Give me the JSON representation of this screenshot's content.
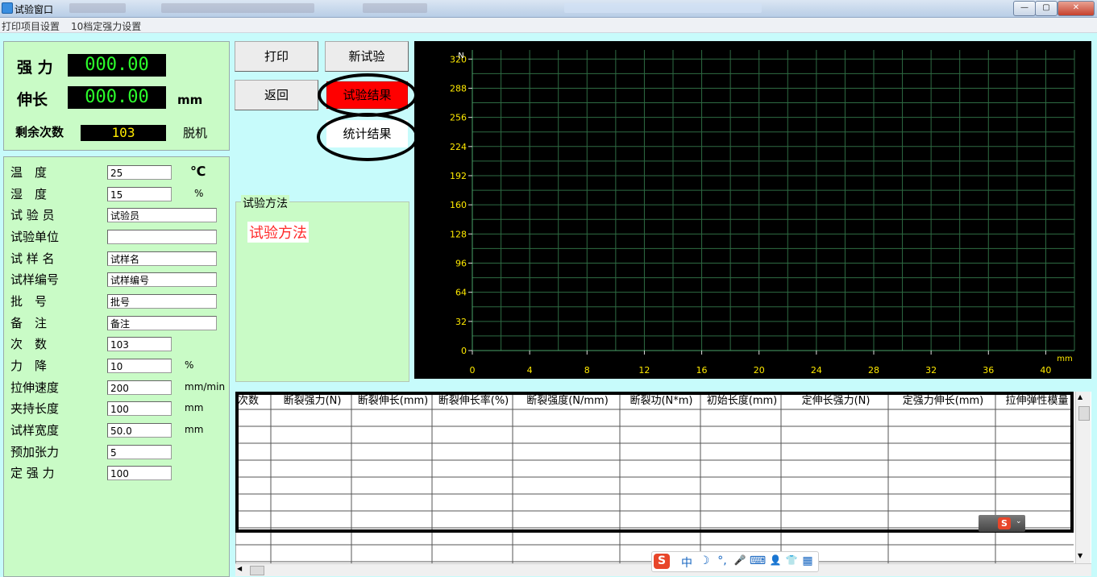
{
  "window": {
    "title": "试验窗口",
    "min": "—",
    "max": "▢",
    "close": "✕"
  },
  "menu": [
    "打印项目设置",
    "10档定强力设置"
  ],
  "readout": {
    "force_label": "强 力",
    "force_value": "000.00",
    "elong_label": "伸长",
    "elong_value": "000.00",
    "elong_unit": "mm",
    "remain_label": "剩余次数",
    "remain_value": "103",
    "status": "脱机"
  },
  "params": [
    {
      "label": "温　度",
      "value": "25",
      "unit": "℃"
    },
    {
      "label": "湿　度",
      "value": "15",
      "unit": "%"
    },
    {
      "label": "试 验 员",
      "value": "试验员",
      "unit": ""
    },
    {
      "label": "试验单位",
      "value": "",
      "unit": ""
    },
    {
      "label": "试 样 名",
      "value": "试样名",
      "unit": ""
    },
    {
      "label": "试样编号",
      "value": "试样编号",
      "unit": ""
    },
    {
      "label": "批　号",
      "value": "批号",
      "unit": ""
    },
    {
      "label": "备　注",
      "value": "备注",
      "unit": ""
    },
    {
      "label": "次　数",
      "value": "103",
      "unit": ""
    },
    {
      "label": "力　降",
      "value": "10",
      "unit": "%"
    },
    {
      "label": "拉伸速度",
      "value": "200",
      "unit": "mm/min"
    },
    {
      "label": "夹持长度",
      "value": "100",
      "unit": "mm"
    },
    {
      "label": "试样宽度",
      "value": "50.0",
      "unit": "mm"
    },
    {
      "label": "预加张力",
      "value": "5",
      "unit": ""
    },
    {
      "label": "定 强 力",
      "value": "100",
      "unit": ""
    }
  ],
  "buttons": {
    "print": "打印",
    "new_test": "新试验",
    "back": "返回",
    "results": "试验结果",
    "stats": "统计结果"
  },
  "method": {
    "group_label": "试验方法",
    "value": "试验方法"
  },
  "colors": {
    "results_button": "#ff0000",
    "chart_grid": "#2e6b43",
    "tick_text": "#ffea00"
  },
  "chart_data": {
    "type": "line",
    "x_ticks": [
      "0",
      "4",
      "8",
      "12",
      "16",
      "20",
      "24",
      "28",
      "32",
      "36",
      "40"
    ],
    "y_ticks": [
      "0",
      "32",
      "64",
      "96",
      "128",
      "160",
      "192",
      "224",
      "256",
      "288",
      "320"
    ],
    "xlabel": "mm",
    "ylabel": "N",
    "xlim": [
      0,
      42
    ],
    "ylim": [
      0,
      330
    ],
    "grid": true,
    "series": []
  },
  "table": {
    "headers": [
      "次数",
      "断裂强力(N)",
      "断裂伸长(mm)",
      "断裂伸长率(%)",
      "断裂强度(N/mm)",
      "断裂功(N*m)",
      "初始长度(mm)",
      "定伸长强力(N)",
      "定强力伸长(mm)",
      "拉伸弹性模量"
    ]
  },
  "ime": [
    "中",
    "☽",
    "°,",
    "🎤",
    "⌨",
    "👤",
    "👕",
    "▦"
  ]
}
